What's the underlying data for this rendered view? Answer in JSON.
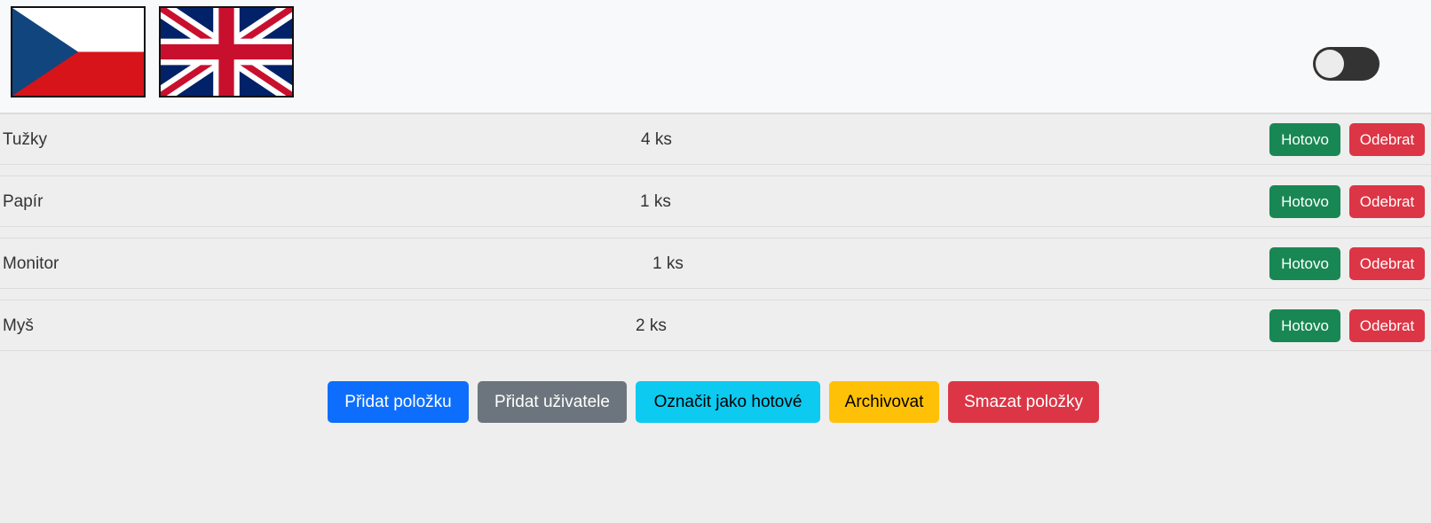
{
  "header": {
    "flags": [
      {
        "icon": "czech-flag-icon"
      },
      {
        "icon": "uk-flag-icon"
      }
    ],
    "theme_toggle": {
      "state": "off"
    }
  },
  "items": [
    {
      "name": "Tužky",
      "quantity": "4 ks",
      "done_label": "Hotovo",
      "remove_label": "Odebrat"
    },
    {
      "name": "Papír",
      "quantity": "1 ks",
      "done_label": "Hotovo",
      "remove_label": "Odebrat"
    },
    {
      "name": "Monitor",
      "quantity": "1 ks",
      "done_label": "Hotovo",
      "remove_label": "Odebrat"
    },
    {
      "name": "Myš",
      "quantity": "2 ks",
      "done_label": "Hotovo",
      "remove_label": "Odebrat"
    }
  ],
  "actions": {
    "add_item": "Přidat položku",
    "add_user": "Přidat uživatele",
    "mark_done": "Označit jako hotové",
    "archive": "Archivovat",
    "delete_items": "Smazat položky"
  },
  "colors": {
    "success": "#198754",
    "danger": "#dc3545",
    "primary": "#0d6efd",
    "secondary": "#6c757d",
    "info": "#0dcaf0",
    "warning": "#ffc107"
  }
}
